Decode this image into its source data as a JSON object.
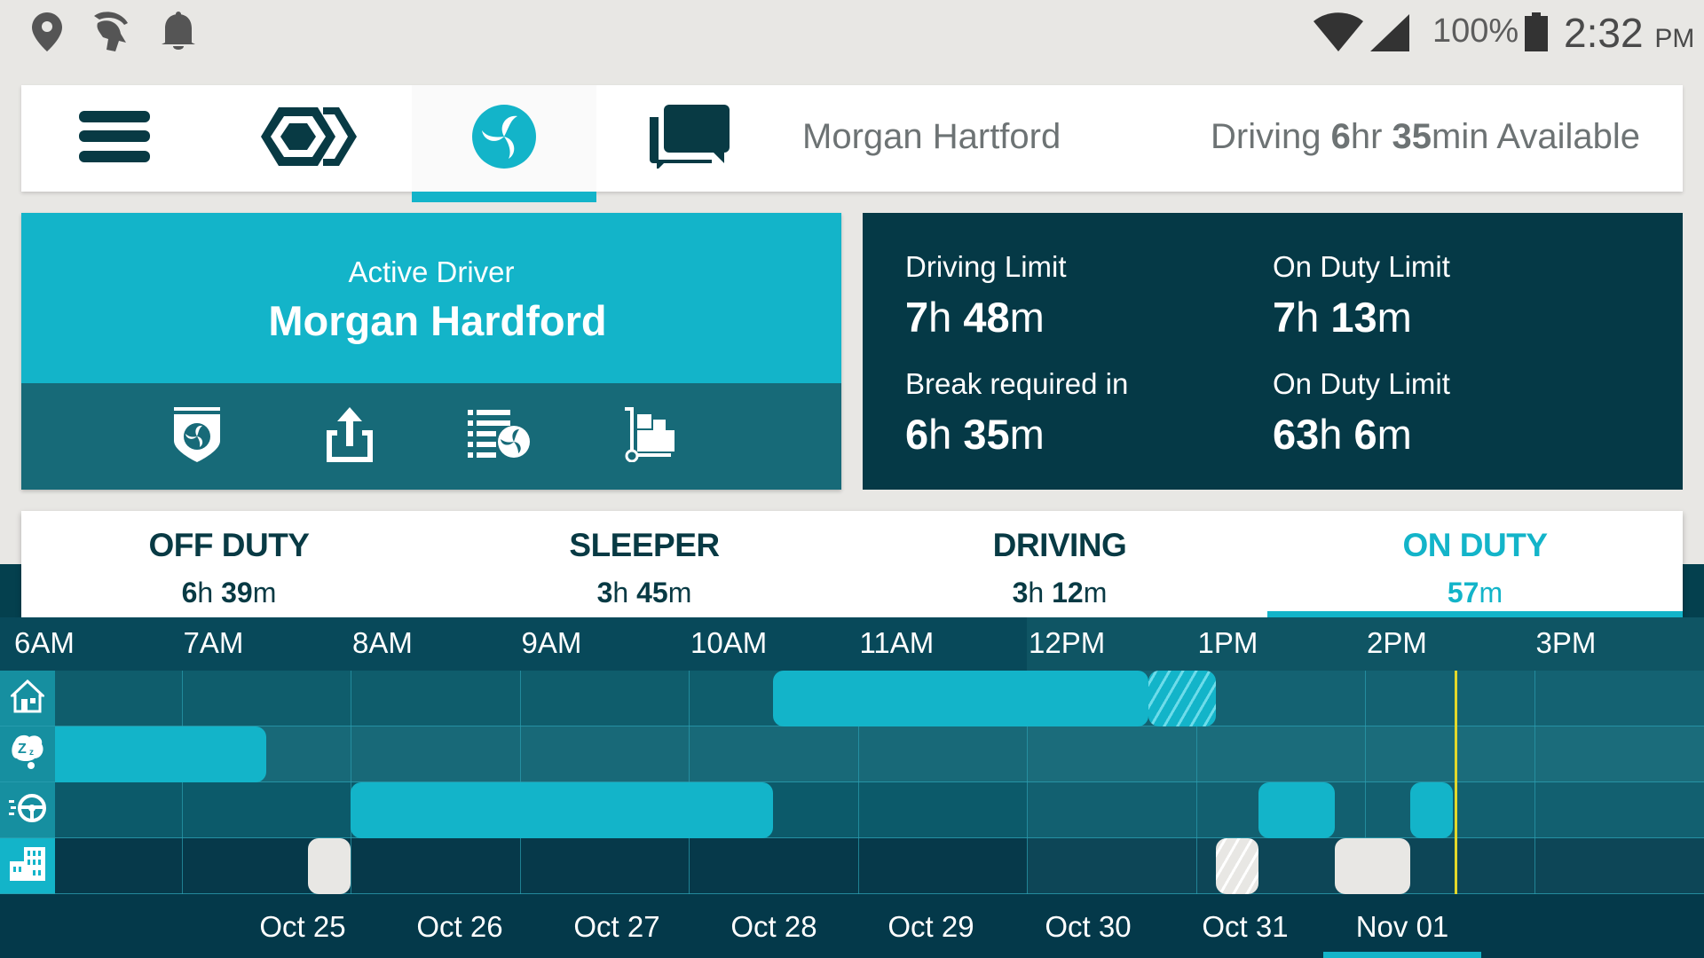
{
  "status_bar": {
    "left_icons": [
      "location-pin-icon",
      "spartan-helmet-icon",
      "notification-bell-icon"
    ],
    "right_icons": [
      "wifi-icon",
      "cell-signal-icon",
      "battery-icon"
    ],
    "battery": "100%",
    "time": "2:32",
    "ampm": "PM"
  },
  "top_nav": {
    "buttons": [
      {
        "name": "menu",
        "icon": "hamburger-menu-icon"
      },
      {
        "name": "logo",
        "icon": "hexagon-logo-icon"
      },
      {
        "name": "hos",
        "icon": "triskelion-icon",
        "active": true
      },
      {
        "name": "messages",
        "icon": "chat-bubbles-icon"
      }
    ],
    "driver_name": "Morgan Hartford",
    "availability": {
      "prefix": "Driving ",
      "hours": "6",
      "hours_unit": "hr ",
      "minutes": "35",
      "minutes_unit": "min Available"
    }
  },
  "driver_card": {
    "label": "Active Driver",
    "name": "Morgan Hardford",
    "actions": [
      {
        "name": "dot-inspection",
        "icon": "shield-badge-icon"
      },
      {
        "name": "share",
        "icon": "share-upload-icon"
      },
      {
        "name": "logs",
        "icon": "log-list-icon"
      },
      {
        "name": "cargo",
        "icon": "hand-truck-icon"
      }
    ]
  },
  "limits": [
    {
      "label": "Driving Limit",
      "h": "7",
      "m": "48"
    },
    {
      "label": "On Duty Limit",
      "h": "7",
      "m": "13"
    },
    {
      "label": "Break required in",
      "h": "6",
      "m": "35"
    },
    {
      "label": "On Duty Limit",
      "h": "63",
      "m": "6"
    }
  ],
  "duty_tabs": [
    {
      "label": "OFF DUTY",
      "h": "6",
      "m": "39",
      "active": false
    },
    {
      "label": "SLEEPER",
      "h": "3",
      "m": "45",
      "active": false
    },
    {
      "label": "DRIVING",
      "h": "3",
      "m": "12",
      "active": false
    },
    {
      "label": "ON DUTY",
      "h": "",
      "m": "57",
      "active": true
    }
  ],
  "timeline": {
    "hours": [
      "6AM",
      "7AM",
      "8AM",
      "9AM",
      "10AM",
      "11AM",
      "12PM",
      "1PM",
      "2PM",
      "3PM"
    ],
    "rows": [
      {
        "status": "off-duty",
        "icon": "house-icon"
      },
      {
        "status": "sleeper",
        "icon": "sleep-zz-icon"
      },
      {
        "status": "driving",
        "icon": "steering-wheel-icon"
      },
      {
        "status": "on-duty",
        "icon": "building-icon"
      }
    ],
    "segments": [
      {
        "row": 0,
        "start": 10.5,
        "end": 12.72,
        "style": "teal"
      },
      {
        "row": 0,
        "start": 12.72,
        "end": 13.12,
        "style": "teal-hatch"
      },
      {
        "row": 1,
        "start": 6.0,
        "end": 7.5,
        "style": "teal"
      },
      {
        "row": 2,
        "start": 8.0,
        "end": 10.5,
        "style": "teal"
      },
      {
        "row": 2,
        "start": 13.37,
        "end": 13.82,
        "style": "teal"
      },
      {
        "row": 2,
        "start": 14.27,
        "end": 14.52,
        "style": "teal"
      },
      {
        "row": 3,
        "start": 7.75,
        "end": 8.0,
        "style": "light"
      },
      {
        "row": 3,
        "start": 13.12,
        "end": 13.37,
        "style": "light-hatch"
      },
      {
        "row": 3,
        "start": 13.82,
        "end": 14.27,
        "style": "light"
      }
    ],
    "now_hour": 14.53
  },
  "dates": [
    {
      "label": "Oct 25",
      "active": false
    },
    {
      "label": "Oct 26",
      "active": false
    },
    {
      "label": "Oct 27",
      "active": false
    },
    {
      "label": "Oct 28",
      "active": false
    },
    {
      "label": "Oct 29",
      "active": false
    },
    {
      "label": "Oct 30",
      "active": false
    },
    {
      "label": "Oct 31",
      "active": false
    },
    {
      "label": "Nov 01",
      "active": true
    }
  ],
  "colors": {
    "accent": "#13b4c9",
    "dark": "#053946",
    "mid": "#176a78",
    "now_marker": "#e3d82a"
  }
}
